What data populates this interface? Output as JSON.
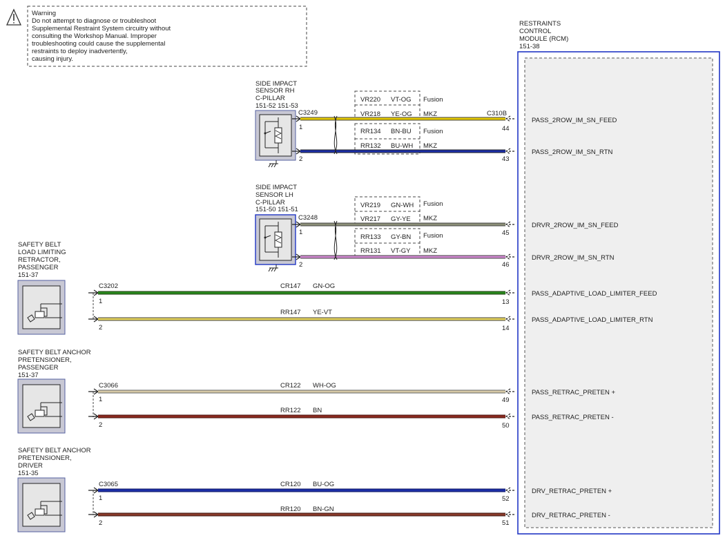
{
  "warning": {
    "title": "Warning",
    "lines": [
      "Do not attempt to diagnose or troubleshoot",
      "Supplemental Restraint System circuitry without",
      "consulting the Workshop Manual. Improper",
      "troubleshooting could cause the supplemental",
      "restraints to deploy inadvertently,",
      "causing injury."
    ]
  },
  "rcm": {
    "label_lines": [
      "RESTRAINTS",
      "CONTROL",
      "MODULE (RCM)",
      "151-38"
    ],
    "connector": "C310B"
  },
  "sensors": [
    {
      "id": "rh",
      "label_lines": [
        "SIDE IMPACT",
        "SENSOR RH",
        "C-PILLAR"
      ],
      "refs": "151-52  151-53",
      "connector": "C3249",
      "pins": [
        "1",
        "2"
      ],
      "variants": [
        {
          "circuit": "VR220",
          "color": "VT-OG",
          "note": "Fusion"
        },
        {
          "circuit": "VR218",
          "color": "YE-OG",
          "note": "MKZ"
        },
        {
          "circuit": "RR134",
          "color": "BN-BU",
          "note": "Fusion"
        },
        {
          "circuit": "RR132",
          "color": "BU-WH",
          "note": "MKZ"
        }
      ],
      "rcm_pins": [
        "44",
        "43"
      ],
      "signals": [
        "PASS_2ROW_IM_SN_FEED",
        "PASS_2ROW_IM_SN_RTN"
      ],
      "wire_colors": [
        "#e3c800",
        "#1c2fa8"
      ]
    },
    {
      "id": "lh",
      "label_lines": [
        "SIDE IMPACT",
        "SENSOR LH",
        "C-PILLAR"
      ],
      "refs": "151-50  151-51",
      "connector": "C3248",
      "pins": [
        "1",
        "2"
      ],
      "variants": [
        {
          "circuit": "VR219",
          "color": "GN-WH",
          "note": "Fusion"
        },
        {
          "circuit": "VR217",
          "color": "GY-YE",
          "note": "MKZ"
        },
        {
          "circuit": "RR133",
          "color": "GY-BN",
          "note": "Fusion"
        },
        {
          "circuit": "RR131",
          "color": "VT-GY",
          "note": "MKZ"
        }
      ],
      "rcm_pins": [
        "45",
        "46"
      ],
      "signals": [
        "DRVR_2ROW_IM_SN_FEED",
        "DRVR_2ROW_IM_SN_RTN"
      ],
      "wire_colors": [
        "#8c8f78",
        "#cf87cf"
      ]
    }
  ],
  "devices": [
    {
      "id": "load-limiter-passenger",
      "label_lines": [
        "SAFETY BELT",
        "LOAD LIMITING",
        "RETRACTOR,",
        "PASSENGER",
        "151-37"
      ],
      "connector": "C3202",
      "wires": [
        {
          "pin": "1",
          "circuit": "CR147",
          "color": "GN-OG",
          "rcm_pin": "13",
          "signal": "PASS_ADAPTIVE_LOAD_LIMITER_FEED",
          "swatch": "#2a8a1e"
        },
        {
          "pin": "2",
          "circuit": "RR147",
          "color": "YE-VT",
          "rcm_pin": "14",
          "signal": "PASS_ADAPTIVE_LOAD_LIMITER_RTN",
          "swatch": "#e4d25a"
        }
      ]
    },
    {
      "id": "anchor-pretensioner-passenger",
      "label_lines": [
        "SAFETY BELT ANCHOR",
        "PRETENSIONER,",
        "PASSENGER",
        "151-37"
      ],
      "connector": "C3066",
      "wires": [
        {
          "pin": "1",
          "circuit": "CR122",
          "color": "WH-OG",
          "rcm_pin": "49",
          "signal": "PASS_RETRAC_PRETEN +",
          "swatch": "#d6c9a6"
        },
        {
          "pin": "2",
          "circuit": "RR122",
          "color": "BN",
          "rcm_pin": "50",
          "signal": "PASS_RETRAC_PRETEN -",
          "swatch": "#8a2a1f"
        }
      ]
    },
    {
      "id": "anchor-pretensioner-driver",
      "label_lines": [
        "SAFETY BELT ANCHOR",
        "PRETENSIONER,",
        "DRIVER",
        "151-35"
      ],
      "connector": "C3065",
      "wires": [
        {
          "pin": "1",
          "circuit": "CR120",
          "color": "BU-OG",
          "rcm_pin": "52",
          "signal": "DRV_RETRAC_PRETEN +",
          "swatch": "#1c2fa8"
        },
        {
          "pin": "2",
          "circuit": "RR120",
          "color": "BN-GN",
          "rcm_pin": "51",
          "signal": "DRV_RETRAC_PRETEN -",
          "swatch": "#8a3b2a"
        }
      ]
    }
  ]
}
